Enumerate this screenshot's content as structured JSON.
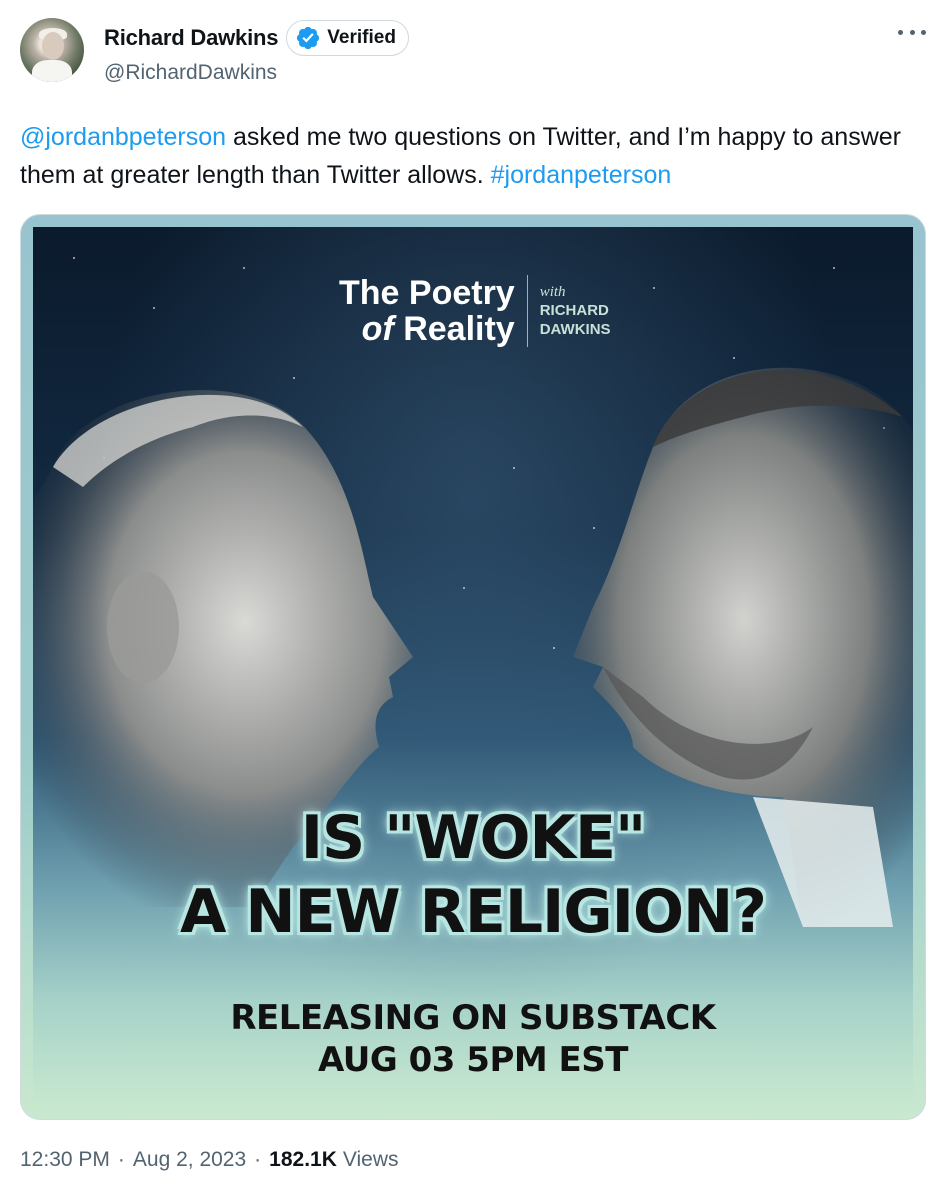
{
  "author": {
    "display_name": "Richard Dawkins",
    "verified_label": "Verified",
    "handle": "@RichardDawkins"
  },
  "tweet": {
    "mention": "@jordanbpeterson",
    "text_mid": " asked me two questions on Twitter, and I’m happy to answer them at greater length than Twitter allows. ",
    "hashtag": "#jordanpeterson"
  },
  "media": {
    "brand_title_line1": "The Poetry",
    "brand_title_of": "of",
    "brand_title_reality": " Reality",
    "brand_with": "with",
    "brand_name_line1": "RICHARD",
    "brand_name_line2": "DAWKINS",
    "headline_line1": "IS \"WOKE\"",
    "headline_line2": "A NEW RELIGION?",
    "subline_line1": "RELEASING ON SUBSTACK",
    "subline_line2": "AUG 03 5PM EST"
  },
  "meta": {
    "time": "12:30 PM",
    "separator": "·",
    "date": "Aug 2, 2023",
    "views_count": "182.1K",
    "views_label": "Views"
  },
  "colors": {
    "link": "#1d9bf0",
    "secondary_text": "#536471",
    "primary_text": "#0f1419",
    "verified_badge": "#1d9bf0"
  },
  "icons": {
    "verified": "verified-badge-icon",
    "more": "more-options-icon"
  }
}
